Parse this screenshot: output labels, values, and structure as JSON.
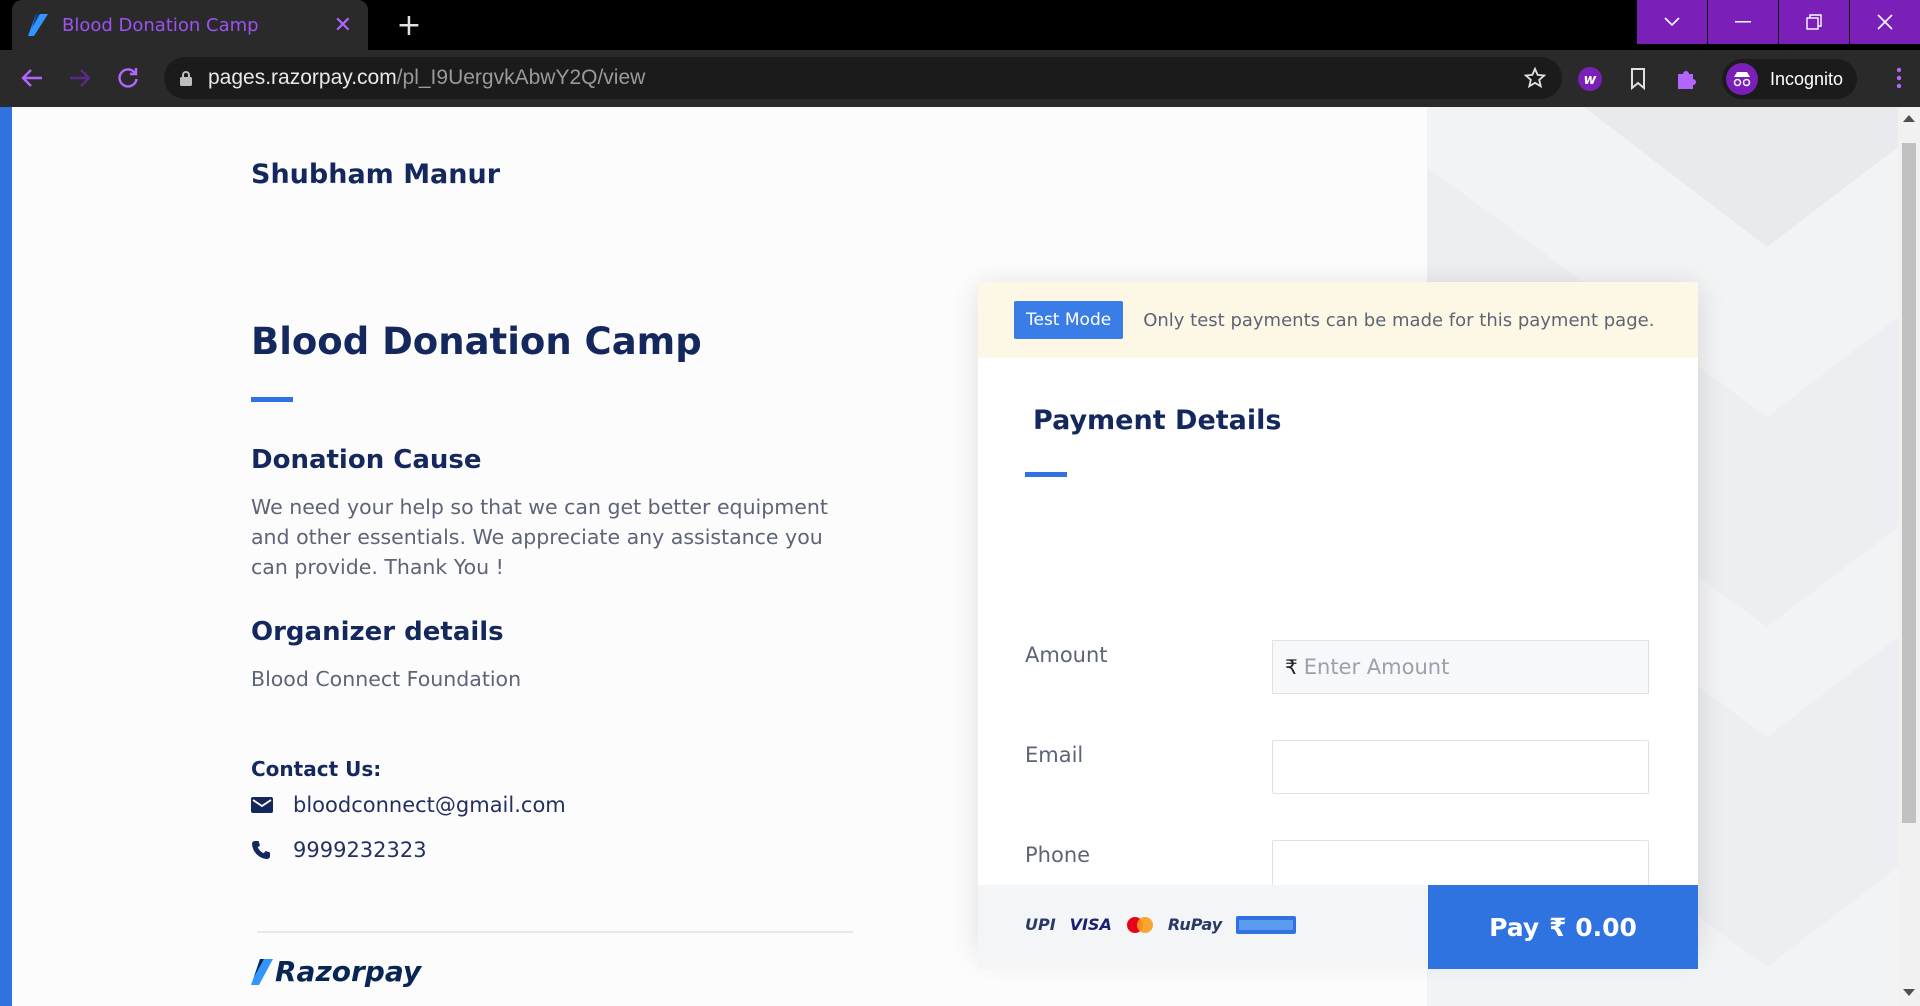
{
  "browser": {
    "tab_title": "Blood Donation Camp",
    "url_host": "pages.razorpay.com",
    "url_path": "/pl_I9UergvkAbwY2Q/view",
    "profile_label": "Incognito",
    "accent_color": "#7a1fb8"
  },
  "page": {
    "merchant_name": "Shubham Manur",
    "title": "Blood Donation Camp",
    "cause_heading": "Donation Cause",
    "cause_text": "We need your help so that we can get better equipment and other essentials. We appreciate any assistance you can provide. Thank You !",
    "organizer_heading": "Organizer details",
    "organizer_name": "Blood Connect Foundation",
    "contact_heading": "Contact Us:",
    "contact_email": "bloodconnect@gmail.com",
    "contact_phone": "9999232323",
    "brand": "Razorpay",
    "accent_color": "#2f73e0"
  },
  "payment": {
    "test_badge": "Test Mode",
    "test_message": "Only test payments can be made for this payment page.",
    "title": "Payment Details",
    "currency_symbol": "₹",
    "fields": {
      "amount_label": "Amount",
      "amount_placeholder": "Enter Amount",
      "email_label": "Email",
      "phone_label": "Phone"
    },
    "methods": [
      "UPI",
      "VISA",
      "Mastercard",
      "RuPay",
      "Netbanking"
    ],
    "pay_label": "Pay",
    "pay_amount": "₹ 0.00"
  }
}
